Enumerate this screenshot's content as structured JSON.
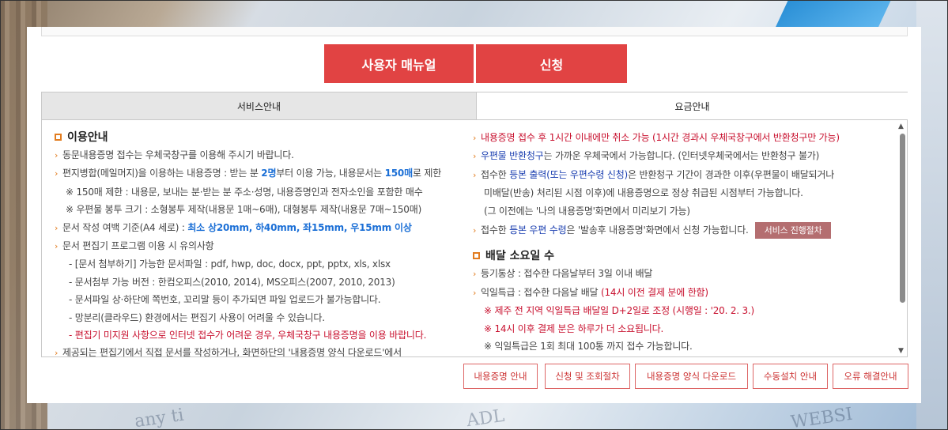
{
  "buttons": {
    "manual": "사용자 매뉴얼",
    "apply": "신청"
  },
  "tabs": [
    {
      "label": "서비스안내"
    },
    {
      "label": "요금안내"
    }
  ],
  "left": {
    "title": "이용안내",
    "l1": "동문내용증명 접수는 우체국창구를 이용해 주시기 바랍니다.",
    "l2a": "편지병합(메일머지)을 이용하는 내용증명 : 받는 분 ",
    "l2b": "2명",
    "l2c": "부터 이용 가능, 내용문서는 ",
    "l2d": "150매",
    "l2e": "로 제한",
    "l3": "※ 150매 제한 : 내용문, 보내는 분·받는 분 주소·성명, 내용증명인과 전자소인을 포함한 매수",
    "l4": "※ 우편물 봉투 크기 : 소형봉투 제작(내용문 1매~6매), 대형봉투 제작(내용문 7매~150매)",
    "l5a": "문서 작성 여백 기준(A4 세로) : ",
    "l5b": "최소 상20mm, 하40mm, 좌15mm, 우15mm 이상",
    "l6": "문서 편집기 프로그램 이용 시 유의사항",
    "l7": "- [문서 첨부하기] 가능한 문서파일 : pdf, hwp, doc, docx, ppt, pptx, xls, xlsx",
    "l8": "- 문서첨부 가능 버전 : 한컴오피스(2010, 2014), MS오피스(2007, 2010, 2013)",
    "l9": "- 문서파일 상·하단에 쪽번호, 꼬리말 등이 추가되면 파일 업로드가 불가능합니다.",
    "l10": "- 망분리(클라우드) 환경에서는 편집기 사용이 어려울 수 있습니다.",
    "l11": "- 편집기 미지원 사항으로 인터넷 접수가 어려운 경우, 우체국창구 내용증명을 이용 바랍니다.",
    "l12": "제공되는 편집기에서 직접 문서를 작성하거나, 화면하단의 '내용증명 양식 다운로드'에서"
  },
  "right": {
    "r1": "내용증명 접수 후 1시간 이내에만 취소 가능 (1시간 경과시 우체국창구에서 반환청구만 가능)",
    "r2a": "우편물 반환청구",
    "r2b": "는 가까운 우체국에서 가능합니다. (인터넷우체국에서는 반환청구 불가)",
    "r3a": "접수한 ",
    "r3b": "등본 출력(또는 우편수령 신청)",
    "r3c": "은 반환청구 기간이 경과한 이후(우편물이 배달되거나",
    "r4": "미배달(반송) 처리된 시점 이후)에 내용증명으로 정상 취급된 시점부터 가능합니다.",
    "r5": "(그 이전에는 '나의 내용증명'화면에서 미리보기 가능)",
    "r6a": "접수한 ",
    "r6b": "등본 우편 수령",
    "r6c": "은 '발송후 내용증명'화면에서 신청 가능합니다.",
    "process_btn": "서비스 진행절차",
    "title2": "배달 소요일 수",
    "r7": "등기통상 : 접수한 다음날부터 3일 이내 배달",
    "r8a": "익일특급 : 접수한 다음날 배달 ",
    "r8b": "(14시 이전 결제 분에 한함)",
    "r9": "※ 제주 전 지역 익일특급 배달일 D+2일로 조정 (시행일 : '20. 2. 3.)",
    "r10": "※ 14시 이후 결제 분은 하루가 더 소요됩니다.",
    "r11": "※ 익일특급은 1회 최대 100통 까지 접수 가능합니다."
  },
  "bottom_buttons": [
    {
      "label": "내용증명 안내"
    },
    {
      "label": "신청 및 조회절차"
    },
    {
      "label": "내용증명 양식 다운로드"
    },
    {
      "label": "수동설치 안내"
    },
    {
      "label": "오류 해결안내"
    }
  ],
  "colors": {
    "accent_red": "#e14343",
    "orange": "#e27c1f",
    "blue": "#1b6fd6",
    "text_red": "#c8102e"
  }
}
